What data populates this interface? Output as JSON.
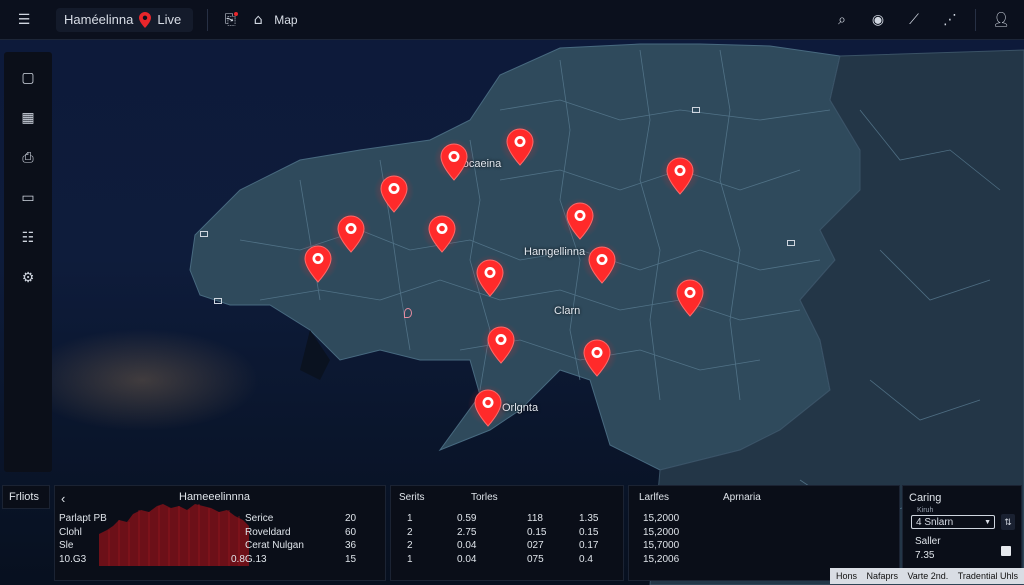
{
  "topbar": {
    "menu_icon": "hamburger-icon",
    "app_title": "Haméelinna",
    "live_label": "Live",
    "map_label": "Map",
    "right_icons": [
      "search-icon",
      "coin-icon",
      "slash-icon",
      "signal-icon",
      "user-icon"
    ]
  },
  "sidebar": {
    "icons": [
      "chat-icon",
      "building-icon",
      "document-icon",
      "monitor-icon",
      "list-icon",
      "settings-icon"
    ]
  },
  "map": {
    "labels": {
      "top": "Focaeina",
      "center": "Hamgellinna",
      "clarn": "Clarn",
      "south": "Orlgnta"
    },
    "pin_color": "#ff2a2a"
  },
  "bottom": {
    "left_tab": "Frliots",
    "chart_panel": {
      "back": "‹",
      "title": "Hameeelinnna",
      "legend": [
        "Parlapt PB",
        "Clohl",
        "Sle",
        "10.G3"
      ],
      "bottom_value": "0.8G.13"
    },
    "service_list": {
      "rows": [
        {
          "name": "Serice",
          "value": "20"
        },
        {
          "name": "Roveldard",
          "value": "60"
        },
        {
          "name": "Cerat Nulgan",
          "value": "36"
        },
        {
          "name": "",
          "value": "15"
        }
      ]
    },
    "stats_table": {
      "headers": [
        "Serits",
        "Torles"
      ],
      "rows": [
        [
          "1",
          "0.59",
          "118",
          "1.35"
        ],
        [
          "2",
          "2.75",
          "0.15",
          "0.15"
        ],
        [
          "2",
          "0.04",
          "027",
          "0.17"
        ],
        [
          "1",
          "0.04",
          "075",
          "0.4"
        ]
      ]
    },
    "loc_panel": {
      "headers": [
        "Larlfes",
        "Aprnaria"
      ],
      "rows": [
        "15,2000",
        "15,2000",
        "15,7000",
        "15,2006"
      ]
    },
    "settings_panel": {
      "title": "Caring",
      "small_label": "Kiruh",
      "select_value": "4 Snlarn",
      "sub_label": "Saller",
      "sub_value": "7.35"
    }
  },
  "attribution": [
    "Hons",
    "Nafaprs",
    "Varte 2nd.",
    "Tradential Uhls"
  ]
}
